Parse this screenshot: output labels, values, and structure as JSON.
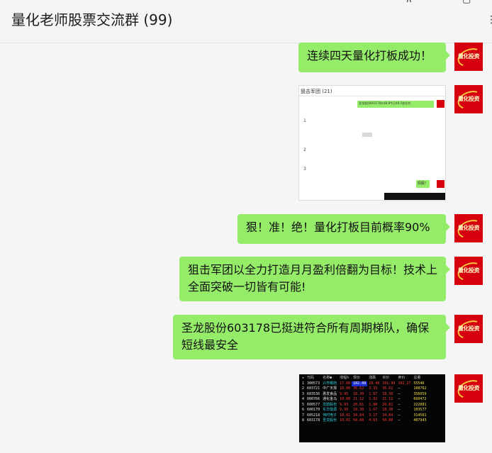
{
  "window": {
    "title": "量化老师股票交流群 (99)",
    "controls": {
      "pin": "⊼",
      "minimize": "—",
      "maximize": "▢",
      "more": "⋮"
    }
  },
  "avatar_label": "量化投资",
  "messages": [
    {
      "type": "text",
      "text": "连续四天量化打板成功！"
    },
    {
      "type": "image",
      "image": {
        "title": "狙击军团 (21)",
        "bubble_top": "圣龙股份603178价48.8今日48.5加仓合",
        "bubble_bottom": "佩服！",
        "unread_numbers": [
          "1",
          "2",
          "3"
        ]
      }
    },
    {
      "type": "text",
      "text": "狠！准！绝！量化打板目前概率90%"
    },
    {
      "type": "text",
      "text": "狙击军团以全力打造月月盈利倍翻为目标！技术上全面突破一切皆有可能!"
    },
    {
      "type": "text",
      "text": "圣龙股份603178已挺进符合所有周期梯队，确保短线最安全"
    },
    {
      "type": "image",
      "image": {
        "columns": [
          "★",
          "代码",
          "名称●",
          "涨幅%",
          "现价",
          "涨跌",
          "买价",
          "卖价",
          "总量"
        ],
        "rows": [
          [
            "1",
            "300573",
            "兴齐眼药",
            "17.68",
            "102.08",
            "29.49",
            "101.99",
            "102.27",
            "55546"
          ],
          [
            "2",
            "603721",
            "中广天择",
            "10.00",
            "36.62",
            "3.33",
            "36.62",
            "—",
            "108762"
          ],
          [
            "3",
            "603536",
            "惠发食品",
            "9.95",
            "18.30",
            "1.67",
            "18.30",
            "—",
            "356059"
          ],
          [
            "4",
            "000766",
            "通化金马",
            "10.08",
            "21.12",
            "1.92",
            "21.12",
            "—",
            "660472"
          ],
          [
            "5",
            "600577",
            "龙韵股份",
            "9.93",
            "20.81",
            "1.88",
            "20.81",
            "—",
            "222881"
          ],
          [
            "6",
            "600170",
            "东华能源",
            "9.99",
            "18.30",
            "1.67",
            "18.30",
            "—",
            "103577"
          ],
          [
            "7",
            "605218",
            "伟时电子",
            "10.01",
            "34.84",
            "3.17",
            "34.84",
            "—",
            "314561"
          ],
          [
            "8",
            "603178",
            "圣龙股份",
            "10.01",
            "50.80",
            "4.63",
            "50.80",
            "—",
            "407943"
          ]
        ]
      }
    }
  ]
}
